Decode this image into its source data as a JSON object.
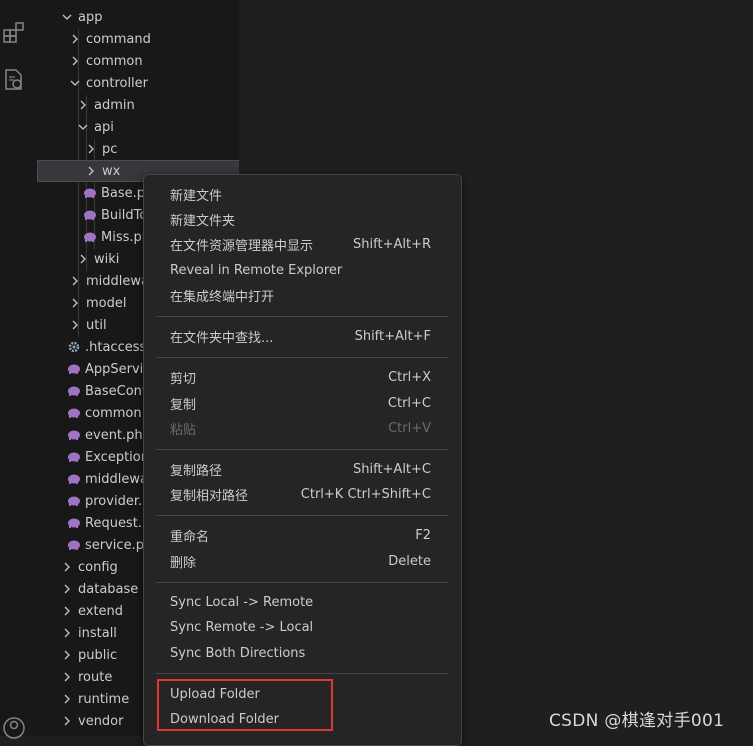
{
  "activity_bar": {
    "icons": [
      "extensions-icon",
      "remote-explorer-icon",
      "accounts-icon"
    ]
  },
  "tree": {
    "top_partial": "",
    "rows": [
      {
        "label": "app",
        "type": "folder",
        "expanded": true
      },
      {
        "label": "command",
        "type": "folder",
        "expanded": false
      },
      {
        "label": "common",
        "type": "folder",
        "expanded": false
      },
      {
        "label": "controller",
        "type": "folder",
        "expanded": true
      },
      {
        "label": "admin",
        "type": "folder",
        "expanded": false
      },
      {
        "label": "api",
        "type": "folder",
        "expanded": true
      },
      {
        "label": "pc",
        "type": "folder",
        "expanded": false
      },
      {
        "label": "wx",
        "type": "folder",
        "expanded": false,
        "selected": true
      },
      {
        "label": "Base.ph",
        "type": "php"
      },
      {
        "label": "BuildTo",
        "type": "php"
      },
      {
        "label": "Miss.ph",
        "type": "php"
      },
      {
        "label": "wiki",
        "type": "folder",
        "expanded": false
      },
      {
        "label": "middlewa",
        "type": "folder",
        "expanded": false
      },
      {
        "label": "model",
        "type": "folder",
        "expanded": false
      },
      {
        "label": "util",
        "type": "folder",
        "expanded": false
      },
      {
        "label": ".htaccess",
        "type": "config"
      },
      {
        "label": "AppServic",
        "type": "php"
      },
      {
        "label": "BaseContr",
        "type": "php"
      },
      {
        "label": "common.p",
        "type": "php"
      },
      {
        "label": "event.php",
        "type": "php"
      },
      {
        "label": "Exception",
        "type": "php"
      },
      {
        "label": "middlewa",
        "type": "php"
      },
      {
        "label": "provider.p",
        "type": "php"
      },
      {
        "label": "Request.p",
        "type": "php"
      },
      {
        "label": "service.ph",
        "type": "php"
      },
      {
        "label": "config",
        "type": "folder",
        "expanded": false
      },
      {
        "label": "database",
        "type": "folder",
        "expanded": false
      },
      {
        "label": "extend",
        "type": "folder",
        "expanded": false
      },
      {
        "label": "install",
        "type": "folder",
        "expanded": false
      },
      {
        "label": "public",
        "type": "folder",
        "expanded": false
      },
      {
        "label": "route",
        "type": "folder",
        "expanded": false
      },
      {
        "label": "runtime",
        "type": "folder",
        "expanded": false
      },
      {
        "label": "vendor",
        "type": "folder",
        "expanded": false
      }
    ]
  },
  "context_menu": {
    "groups": [
      [
        {
          "label": "新建文件",
          "key": ""
        },
        {
          "label": "新建文件夹",
          "key": ""
        },
        {
          "label": "在文件资源管理器中显示",
          "key": "Shift+Alt+R"
        },
        {
          "label": "Reveal in Remote Explorer",
          "key": ""
        },
        {
          "label": "在集成终端中打开",
          "key": ""
        }
      ],
      [
        {
          "label": "在文件夹中查找...",
          "key": "Shift+Alt+F"
        }
      ],
      [
        {
          "label": "剪切",
          "key": "Ctrl+X"
        },
        {
          "label": "复制",
          "key": "Ctrl+C"
        },
        {
          "label": "粘贴",
          "key": "Ctrl+V",
          "disabled": true
        }
      ],
      [
        {
          "label": "复制路径",
          "key": "Shift+Alt+C"
        },
        {
          "label": "复制相对路径",
          "key": "Ctrl+K Ctrl+Shift+C"
        }
      ],
      [
        {
          "label": "重命名",
          "key": "F2"
        },
        {
          "label": "删除",
          "key": "Delete"
        }
      ],
      [
        {
          "label": "Sync Local -> Remote",
          "key": ""
        },
        {
          "label": "Sync Remote -> Local",
          "key": ""
        },
        {
          "label": "Sync Both Directions",
          "key": ""
        }
      ],
      [
        {
          "label": "Upload Folder",
          "key": ""
        },
        {
          "label": "Download Folder",
          "key": ""
        }
      ]
    ]
  },
  "watermark": "CSDN @棋逢对手001",
  "colors": {
    "php_icon": "#a074c4",
    "highlight": "#e03535",
    "selection": "#37373d"
  }
}
